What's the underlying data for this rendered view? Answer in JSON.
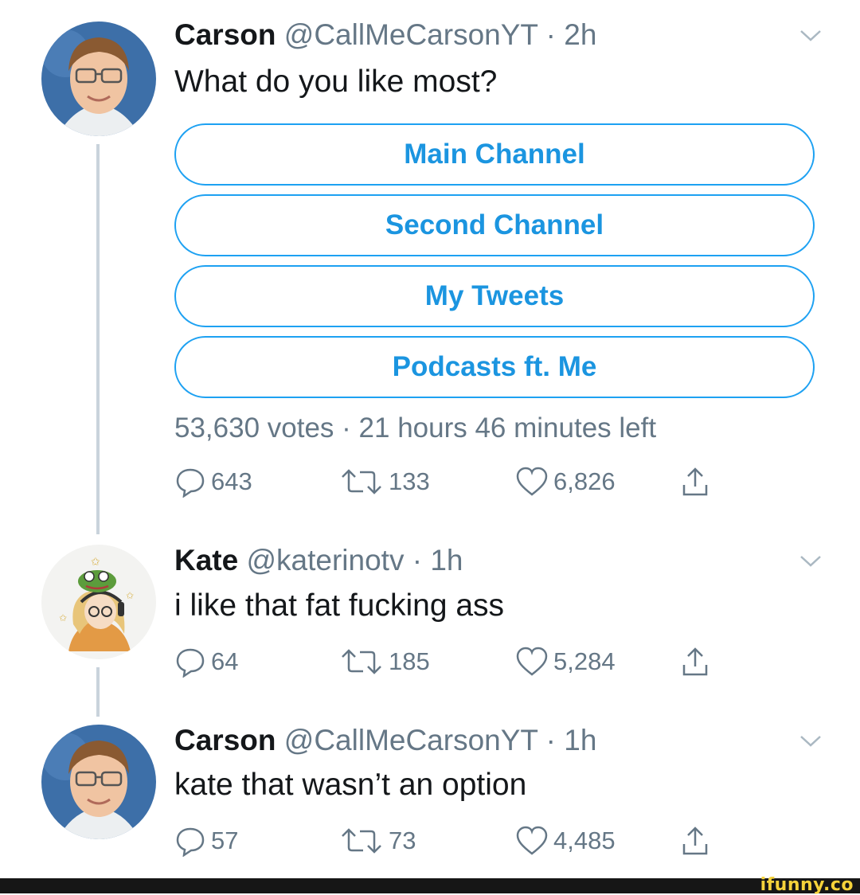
{
  "tweets": [
    {
      "name": "Carson",
      "handle": "@CallMeCarsonYT",
      "time": "· 2h",
      "text": "What do you like most?",
      "replies": "643",
      "retweets": "133",
      "likes": "6,826"
    },
    {
      "name": "Kate",
      "handle": "@katerinotv",
      "time": "· 1h",
      "text": "i like that fat fucking ass",
      "replies": "64",
      "retweets": "185",
      "likes": "5,284"
    },
    {
      "name": "Carson",
      "handle": "@CallMeCarsonYT",
      "time": "· 1h",
      "text": "kate that wasn’t an option",
      "replies": "57",
      "retweets": "73",
      "likes": "4,485"
    }
  ],
  "poll": {
    "options": [
      "Main Channel",
      "Second Channel",
      "My Tweets",
      "Podcasts ft. Me"
    ],
    "summary": "53,630 votes · 21 hours 46 minutes left"
  },
  "watermark": "ifunny.co",
  "colors": {
    "accent": "#1da1f2",
    "muted": "#657786",
    "thread_line": "#c9d3dc"
  },
  "icons": [
    "reply-icon",
    "retweet-icon",
    "like-icon",
    "share-icon",
    "chevron-down-icon"
  ]
}
